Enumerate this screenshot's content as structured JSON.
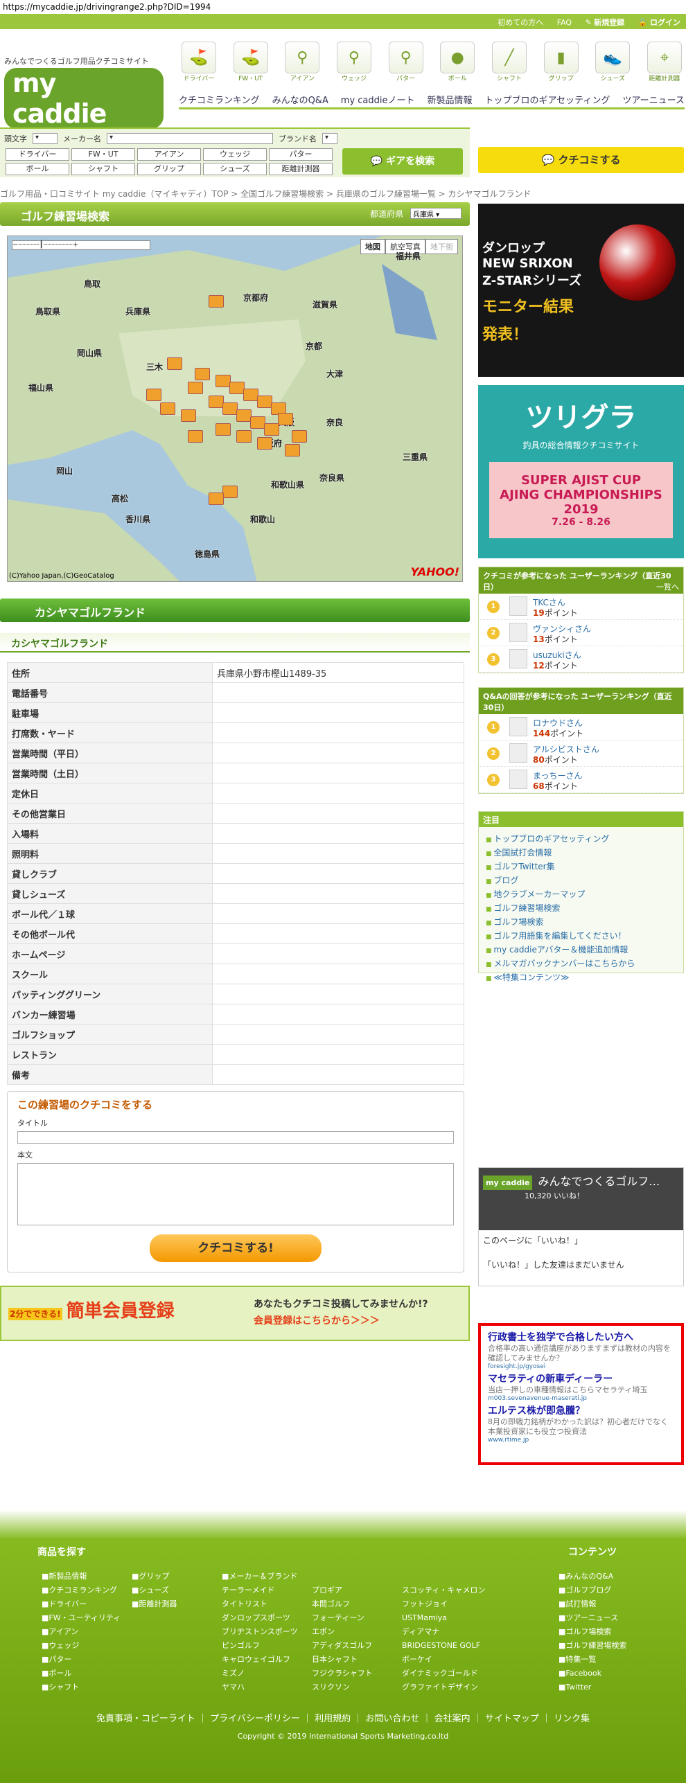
{
  "url": "https://mycaddie.jp/drivingrange2.php?DID=1994",
  "topbar": {
    "first": "初めての方へ",
    "faq": "FAQ",
    "register": "新規登録",
    "login": "ログイン"
  },
  "logo": {
    "tagline": "みんなでつくるゴルフ用品クチコミサイト",
    "brand": "my caddie"
  },
  "categories": [
    {
      "label": "ドライバー",
      "icon": "driver-icon"
    },
    {
      "label": "FW・UT",
      "icon": "fairway-wood-icon"
    },
    {
      "label": "アイアン",
      "icon": "iron-icon"
    },
    {
      "label": "ウェッジ",
      "icon": "wedge-icon"
    },
    {
      "label": "パター",
      "icon": "putter-icon"
    },
    {
      "label": "ボール",
      "icon": "ball-icon"
    },
    {
      "label": "シャフト",
      "icon": "shaft-icon"
    },
    {
      "label": "グリップ",
      "icon": "grip-icon"
    },
    {
      "label": "シューズ",
      "icon": "shoes-icon"
    },
    {
      "label": "距離計測器",
      "icon": "rangefinder-icon"
    }
  ],
  "nav": [
    "クチコミランキング",
    "みんなのQ&A",
    "my caddieノート",
    "新製品情報",
    "トップブロのギアセッティング",
    "ツアーニュース"
  ],
  "search": {
    "initial_label": "頭文字",
    "maker_label": "メーカー名",
    "brand_label": "ブランド名",
    "genres": [
      "ドライバー",
      "FW・UT",
      "アイアン",
      "ウェッジ",
      "パター",
      "",
      "ボール",
      "シャフト",
      "グリップ",
      "シューズ",
      "距離計測器",
      ""
    ],
    "gear_button": "ギアを検索"
  },
  "kuchikomi_button": "クチコミする",
  "breadcrumb": "ゴルフ用品・口コミサイト my caddie（マイキャディ）TOP > 全国ゴルフ練習場検索 > 兵庫県のゴルフ練習場一覧 > カシヤマゴルフランド",
  "range_search": {
    "title": "ゴルフ練習場検索",
    "pref_label": "都道府県",
    "pref_value": "兵庫県"
  },
  "map": {
    "tabs": [
      "地図",
      "航空写真",
      "地下街"
    ],
    "copyright": "(C)Yahoo Japan,(C)GeoCatalog",
    "logo": "YAHOO!",
    "places": [
      "福井県",
      "鳥取",
      "兵庫県",
      "京都府",
      "滋賀県",
      "岡山県",
      "京都",
      "大津",
      "大阪",
      "奈良",
      "大阪府",
      "三重県",
      "岡山",
      "高松",
      "香川県",
      "和歌山県",
      "徳島県",
      "奈良県",
      "鳥取県",
      "福山県",
      "三木",
      "和歌山"
    ]
  },
  "title": "カシヤマゴルフランド",
  "subtitle": "カシヤマゴルフランド",
  "info": [
    {
      "k": "住所",
      "v": "兵庫県小野市樫山1489-35"
    },
    {
      "k": "電話番号",
      "v": ""
    },
    {
      "k": "駐車場",
      "v": ""
    },
    {
      "k": "打席数・ヤード",
      "v": ""
    },
    {
      "k": "営業時間（平日）",
      "v": ""
    },
    {
      "k": "営業時間（土日）",
      "v": ""
    },
    {
      "k": "定休日",
      "v": ""
    },
    {
      "k": "その他営業日",
      "v": ""
    },
    {
      "k": "入場料",
      "v": ""
    },
    {
      "k": "照明料",
      "v": ""
    },
    {
      "k": "貸しクラブ",
      "v": ""
    },
    {
      "k": "貸しシューズ",
      "v": ""
    },
    {
      "k": "ボール代／１球",
      "v": ""
    },
    {
      "k": "その他ボール代",
      "v": ""
    },
    {
      "k": "ホームページ",
      "v": ""
    },
    {
      "k": "スクール",
      "v": ""
    },
    {
      "k": "パッティンググリーン",
      "v": ""
    },
    {
      "k": "バンカー練習場",
      "v": ""
    },
    {
      "k": "ゴルフショップ",
      "v": ""
    },
    {
      "k": "レストラン",
      "v": ""
    },
    {
      "k": "備考",
      "v": ""
    }
  ],
  "form": {
    "heading": "この練習場のクチコミをする",
    "title_label": "タイトル",
    "body_label": "本文",
    "submit": "クチコミする!"
  },
  "banner": {
    "badge": "2分でできる!",
    "main": "簡単会員登録",
    "q": "あなたもクチコミ投稿してみませんか!?",
    "cta": "会員登録はこちらから＞＞＞"
  },
  "ad_srixon": {
    "l1": "ダンロップ",
    "l2": "NEW SRIXON",
    "l3": "Z-STARシリーズ",
    "l4": "モニター結果",
    "l5": "発表！"
  },
  "ad_tsurigura": {
    "title": "ツリグラ",
    "sub": "釣具の総合情報クチコミサイト",
    "p1": "SUPER AJIST CUP",
    "p2": "AJING CHAMPIONSHIPS 2019",
    "p3": "7.26 - 8.26"
  },
  "rank1": {
    "title": "クチコミが参考になった ユーザーランキング（直近30日）",
    "more": "一覧へ",
    "items": [
      {
        "name": "TKCさん",
        "pts": "19",
        "unit": "ポイント"
      },
      {
        "name": "ヴァンシィさん",
        "pts": "13",
        "unit": "ポイント"
      },
      {
        "name": "usuzukiさん",
        "pts": "12",
        "unit": "ポイント"
      }
    ]
  },
  "rank2": {
    "title": "Q&Aの回答が参考になった ユーザーランキング（直近30日）",
    "items": [
      {
        "name": "ロナウドさん",
        "pts": "144",
        "unit": "ポイント"
      },
      {
        "name": "アルシビストさん",
        "pts": "80",
        "unit": "ポイント"
      },
      {
        "name": "まっちーさん",
        "pts": "68",
        "unit": "ポイント"
      }
    ]
  },
  "notice": {
    "title": "注目",
    "items": [
      "トップブロのギアセッティング",
      "全国試打会情報",
      "ゴルフTwitter集",
      "ブログ",
      "地クラブメーカーマップ",
      "ゴルフ練習場検索",
      "ゴルフ場検索",
      "ゴルフ用語集を編集してください！",
      "my caddieアバター＆機能追加情報",
      "メルマガバックナンバーはこちらから",
      "≪特集コンテンツ≫"
    ]
  },
  "fb": {
    "page_name": "みんなでつくるゴルフ…",
    "likes": "10,320 いいね！",
    "like_page": "このページに「いいね！」",
    "empty": "「いいね！」した友達はまだいません"
  },
  "ads": [
    {
      "h": "行政書士を独学で合格したい方へ",
      "d": "合格率の高い通信講座がありますまずは教材の内容を確認してみませんか？",
      "u": "foresight.jp/gyosei"
    },
    {
      "h": "マセラティの新車ディーラー",
      "d": "当店一押しの車種情報はこちらマセラティ埼玉",
      "u": "m003.sevenavenue-maserati.jp"
    },
    {
      "h": "エルテス株が即急騰？",
      "d": "8月の即戦力銘柄がわかった訳は？初心者だけでなく本業投資家にも役立つ投資法",
      "u": "www.rtime.jp"
    }
  ],
  "footer": {
    "products_title": "商品を探す",
    "contents_title": "コンテンツ",
    "col1": [
      "■新製品情報",
      "■クチコミランキング",
      "■ドライバー",
      "■FW・ユーティリティ",
      "■アイアン",
      "■ウェッジ",
      "■パター",
      "■ボール",
      "■シャフト"
    ],
    "col2": [
      "■グリップ",
      "■シューズ",
      "■距離計測器"
    ],
    "col3": [
      "■メーカー＆ブランド",
      "テーラーメイド",
      "タイトリスト",
      "ダンロップスポーツ",
      "ブリヂストンスポーツ",
      "ピンゴルフ",
      "キャロウェイゴルフ",
      "ミズノ",
      "ヤマハ"
    ],
    "col4": [
      "",
      "プロギア",
      "本間ゴルフ",
      "フォーティーン",
      "エポン",
      "アディダスゴルフ",
      "日本シャフト",
      "フジクラシャフト",
      "スリクソン"
    ],
    "col5": [
      "",
      "スコッティ・キャメロン",
      "フットジョイ",
      "USTMamiya",
      "ディアマナ",
      "BRIDGESTONE GOLF",
      "ボーケイ",
      "ダイナミックゴールド",
      "グラファイトデザイン"
    ],
    "col6": [
      "■みんなのQ&A",
      "■ゴルフブログ",
      "■試打情報",
      "■ツアーニュース",
      "■ゴルフ場検索",
      "■ゴルフ練習場検索",
      "■特集一覧",
      "■Facebook",
      "■Twitter"
    ],
    "links": "免責事項・コピーライト ｜ プライバシーポリシー ｜ 利用規約 ｜ お問い合わせ ｜ 会社案内 ｜ サイトマップ ｜ リンク集",
    "copyright": "Copyright © 2019 International Sports Marketing,co.ltd"
  }
}
